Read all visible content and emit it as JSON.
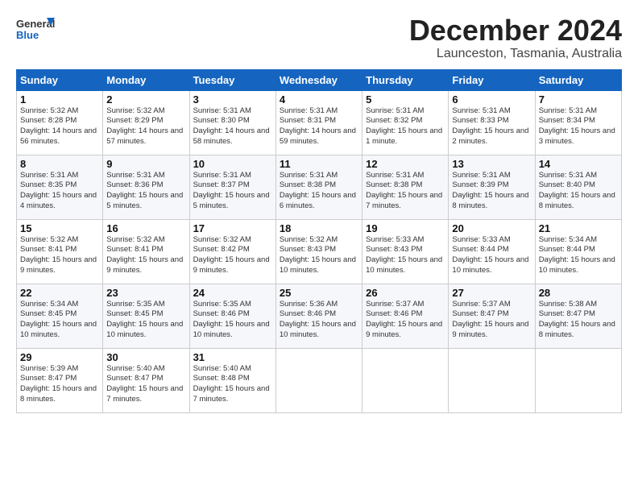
{
  "header": {
    "logo_general": "General",
    "logo_blue": "Blue",
    "month": "December 2024",
    "location": "Launceston, Tasmania, Australia"
  },
  "weekdays": [
    "Sunday",
    "Monday",
    "Tuesday",
    "Wednesday",
    "Thursday",
    "Friday",
    "Saturday"
  ],
  "weeks": [
    [
      {
        "day": "1",
        "sunrise": "5:32 AM",
        "sunset": "8:28 PM",
        "daylight": "14 hours and 56 minutes."
      },
      {
        "day": "2",
        "sunrise": "5:32 AM",
        "sunset": "8:29 PM",
        "daylight": "14 hours and 57 minutes."
      },
      {
        "day": "3",
        "sunrise": "5:31 AM",
        "sunset": "8:30 PM",
        "daylight": "14 hours and 58 minutes."
      },
      {
        "day": "4",
        "sunrise": "5:31 AM",
        "sunset": "8:31 PM",
        "daylight": "14 hours and 59 minutes."
      },
      {
        "day": "5",
        "sunrise": "5:31 AM",
        "sunset": "8:32 PM",
        "daylight": "15 hours and 1 minute."
      },
      {
        "day": "6",
        "sunrise": "5:31 AM",
        "sunset": "8:33 PM",
        "daylight": "15 hours and 2 minutes."
      },
      {
        "day": "7",
        "sunrise": "5:31 AM",
        "sunset": "8:34 PM",
        "daylight": "15 hours and 3 minutes."
      }
    ],
    [
      {
        "day": "8",
        "sunrise": "5:31 AM",
        "sunset": "8:35 PM",
        "daylight": "15 hours and 4 minutes."
      },
      {
        "day": "9",
        "sunrise": "5:31 AM",
        "sunset": "8:36 PM",
        "daylight": "15 hours and 5 minutes."
      },
      {
        "day": "10",
        "sunrise": "5:31 AM",
        "sunset": "8:37 PM",
        "daylight": "15 hours and 5 minutes."
      },
      {
        "day": "11",
        "sunrise": "5:31 AM",
        "sunset": "8:38 PM",
        "daylight": "15 hours and 6 minutes."
      },
      {
        "day": "12",
        "sunrise": "5:31 AM",
        "sunset": "8:38 PM",
        "daylight": "15 hours and 7 minutes."
      },
      {
        "day": "13",
        "sunrise": "5:31 AM",
        "sunset": "8:39 PM",
        "daylight": "15 hours and 8 minutes."
      },
      {
        "day": "14",
        "sunrise": "5:31 AM",
        "sunset": "8:40 PM",
        "daylight": "15 hours and 8 minutes."
      }
    ],
    [
      {
        "day": "15",
        "sunrise": "5:32 AM",
        "sunset": "8:41 PM",
        "daylight": "15 hours and 9 minutes."
      },
      {
        "day": "16",
        "sunrise": "5:32 AM",
        "sunset": "8:41 PM",
        "daylight": "15 hours and 9 minutes."
      },
      {
        "day": "17",
        "sunrise": "5:32 AM",
        "sunset": "8:42 PM",
        "daylight": "15 hours and 9 minutes."
      },
      {
        "day": "18",
        "sunrise": "5:32 AM",
        "sunset": "8:43 PM",
        "daylight": "15 hours and 10 minutes."
      },
      {
        "day": "19",
        "sunrise": "5:33 AM",
        "sunset": "8:43 PM",
        "daylight": "15 hours and 10 minutes."
      },
      {
        "day": "20",
        "sunrise": "5:33 AM",
        "sunset": "8:44 PM",
        "daylight": "15 hours and 10 minutes."
      },
      {
        "day": "21",
        "sunrise": "5:34 AM",
        "sunset": "8:44 PM",
        "daylight": "15 hours and 10 minutes."
      }
    ],
    [
      {
        "day": "22",
        "sunrise": "5:34 AM",
        "sunset": "8:45 PM",
        "daylight": "15 hours and 10 minutes."
      },
      {
        "day": "23",
        "sunrise": "5:35 AM",
        "sunset": "8:45 PM",
        "daylight": "15 hours and 10 minutes."
      },
      {
        "day": "24",
        "sunrise": "5:35 AM",
        "sunset": "8:46 PM",
        "daylight": "15 hours and 10 minutes."
      },
      {
        "day": "25",
        "sunrise": "5:36 AM",
        "sunset": "8:46 PM",
        "daylight": "15 hours and 10 minutes."
      },
      {
        "day": "26",
        "sunrise": "5:37 AM",
        "sunset": "8:46 PM",
        "daylight": "15 hours and 9 minutes."
      },
      {
        "day": "27",
        "sunrise": "5:37 AM",
        "sunset": "8:47 PM",
        "daylight": "15 hours and 9 minutes."
      },
      {
        "day": "28",
        "sunrise": "5:38 AM",
        "sunset": "8:47 PM",
        "daylight": "15 hours and 8 minutes."
      }
    ],
    [
      {
        "day": "29",
        "sunrise": "5:39 AM",
        "sunset": "8:47 PM",
        "daylight": "15 hours and 8 minutes."
      },
      {
        "day": "30",
        "sunrise": "5:40 AM",
        "sunset": "8:47 PM",
        "daylight": "15 hours and 7 minutes."
      },
      {
        "day": "31",
        "sunrise": "5:40 AM",
        "sunset": "8:48 PM",
        "daylight": "15 hours and 7 minutes."
      },
      null,
      null,
      null,
      null
    ]
  ]
}
